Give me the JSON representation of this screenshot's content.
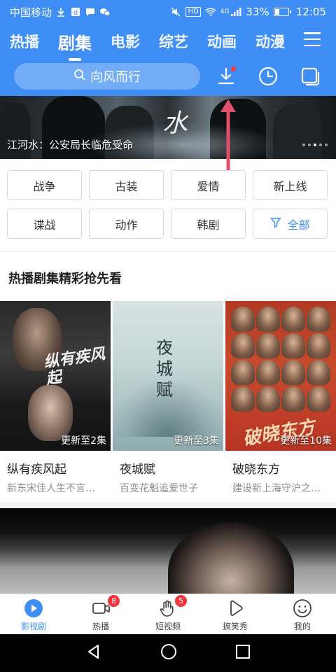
{
  "status_bar": {
    "carrier": "中国移动",
    "network": "4G",
    "battery": "33%",
    "battery_level": 0.33,
    "time": "12:05"
  },
  "top_tabs": [
    {
      "label": "热播",
      "active": false
    },
    {
      "label": "剧集",
      "active": true
    },
    {
      "label": "电影",
      "active": false
    },
    {
      "label": "综艺",
      "active": false
    },
    {
      "label": "动画",
      "active": false
    },
    {
      "label": "动漫",
      "active": false
    }
  ],
  "search": {
    "placeholder": "向风而行"
  },
  "header_icons": [
    "download-icon",
    "history-clock-icon",
    "window-icon"
  ],
  "banner": {
    "title_char": "水",
    "caption": "江河水：公安局长临危受命"
  },
  "categories": [
    "战争",
    "古装",
    "爱情",
    "新上线",
    "谍战",
    "动作",
    "韩剧",
    "全部"
  ],
  "section": {
    "title": "热播剧集精彩抢先看"
  },
  "shows": [
    {
      "name": "纵有疾风起",
      "desc": "新东宋佳人生不言…",
      "badge": "更新至2集",
      "poster_title": "纵有疾风起"
    },
    {
      "name": "夜城赋",
      "desc": "百变花魁追爱世子",
      "badge": "更新至3集",
      "poster_title": "夜城赋"
    },
    {
      "name": "破晓东方",
      "desc": "建设新上海守沪之…",
      "badge": "更新至10集",
      "poster_title": "破晓东方"
    }
  ],
  "bottom_nav": [
    {
      "label": "影视剧",
      "icon": "play-circle-icon",
      "active": true,
      "badge": ""
    },
    {
      "label": "热播",
      "icon": "video-camera-icon",
      "active": false,
      "badge": "8"
    },
    {
      "label": "短视频",
      "icon": "hand-icon",
      "active": false,
      "badge": "5"
    },
    {
      "label": "搞笑秀",
      "icon": "play-triangle-icon",
      "active": false,
      "badge": ""
    },
    {
      "label": "我的",
      "icon": "smiley-icon",
      "active": false,
      "badge": ""
    }
  ],
  "colors": {
    "primary": "#3e8ef5",
    "badge_red": "#f2333a",
    "text_dark": "#222222",
    "text_gray": "#8c8c8c"
  }
}
